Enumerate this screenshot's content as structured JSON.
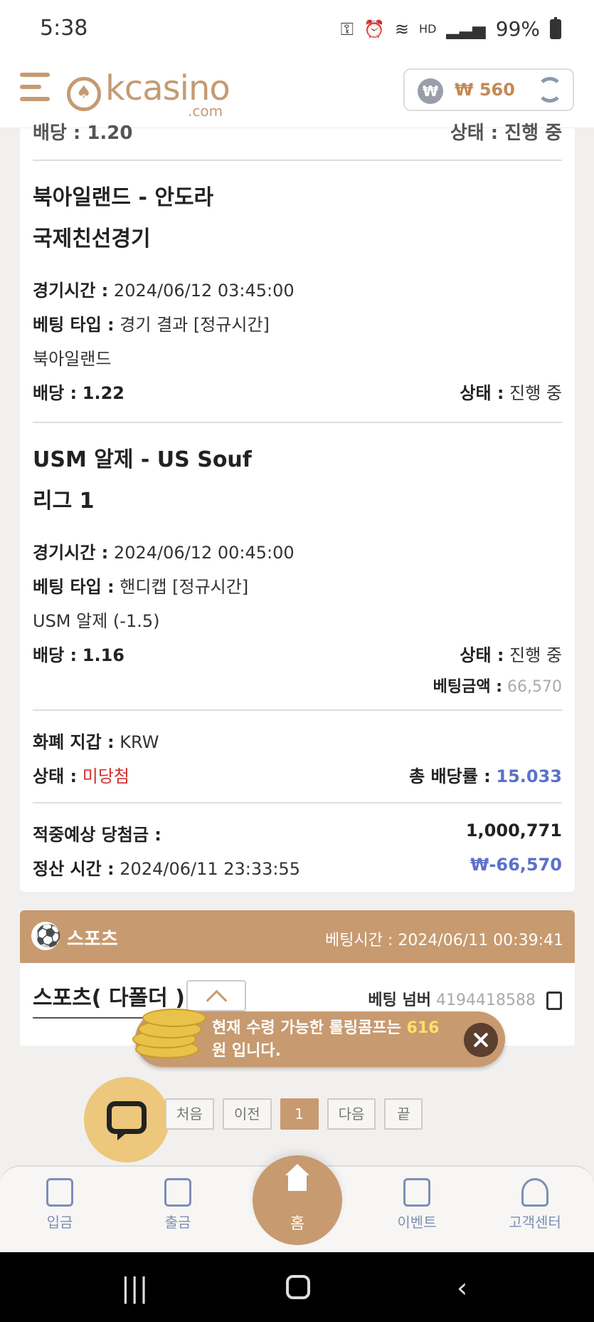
{
  "status_bar": {
    "time": "5:38",
    "battery": "99%",
    "net": "HD"
  },
  "header": {
    "logo_text": "kcasino",
    "logo_sub": ".com",
    "wallet_amount": "₩ 560",
    "won_symbol": "₩"
  },
  "cut_row": {
    "left": "배당 : 1.20",
    "right": "상태 : 진행 중"
  },
  "bets": [
    {
      "match": "북아일랜드 - 안도라",
      "league": "국제친선경기",
      "time_label": "경기시간 :",
      "time": "2024/06/12 03:45:00",
      "type_label": "베팅 타입 :",
      "type": "경기 결과 [정규시간]",
      "pick": "북아일랜드",
      "odds_label": "배당 :",
      "odds": "1.22",
      "status_label": "상태 :",
      "status": "진행 중"
    },
    {
      "match": "USM 알제 - US Souf",
      "league": "리그 1",
      "time_label": "경기시간 :",
      "time": "2024/06/12 00:45:00",
      "type_label": "베팅 타입 :",
      "type": "핸디캡 [정규시간]",
      "pick": "USM 알제 (-1.5)",
      "odds_label": "배당 :",
      "odds": "1.16",
      "status_label": "상태 :",
      "status": "진행 중"
    }
  ],
  "bet_amount": {
    "label": "베팅금액 :",
    "value": "66,570"
  },
  "summary": {
    "currency_label": "화폐 지갑 :",
    "currency": "KRW",
    "status_label": "상태 :",
    "status": "미당첨",
    "total_odds_label": "총 배당률 :",
    "total_odds": "15.033",
    "expected_label": "적중예상 당첨금 :",
    "expected": "1,000,771",
    "settle_label": "정산 시간 :",
    "settle_time": "2024/06/11 23:33:55",
    "settle_amount": "₩-66,570"
  },
  "sports_card": {
    "title": "스포츠",
    "bet_time_label": "베팅시간 :",
    "bet_time": "2024/06/11 00:39:41",
    "type": "스포츠( 다폴더 )",
    "bet_number_label": "베팅 넘버",
    "bet_number": "4194418588"
  },
  "toast": {
    "prefix": "현재 수령 가능한 롤링콤프는",
    "amount": "616",
    "suffix": "원 입니다."
  },
  "pagination": [
    "처음",
    "이전",
    "1",
    "다음",
    "끝"
  ],
  "bottom_nav": {
    "deposit": "입금",
    "withdraw": "출금",
    "home": "홈",
    "event": "이벤트",
    "support": "고객센터"
  },
  "colors": {
    "accent": "#c79a70",
    "link_blue": "#5a72c8",
    "lost_red": "#d32f2f"
  }
}
